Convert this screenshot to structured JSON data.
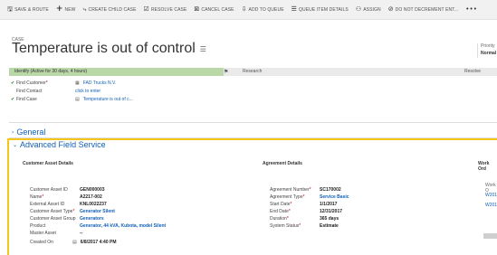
{
  "toolbar": {
    "items": [
      {
        "icon": "save-icon",
        "glyph": "🖫",
        "label": "SAVE & ROUTE"
      },
      {
        "icon": "add-icon",
        "glyph": "+",
        "label": "NEW"
      },
      {
        "icon": "create-child-icon",
        "glyph": "⤷",
        "label": "CREATE CHILD CASE"
      },
      {
        "icon": "resolve-icon",
        "glyph": "☑",
        "label": "RESOLVE CASE"
      },
      {
        "icon": "cancel-case-icon",
        "glyph": "⊠",
        "label": "CANCEL CASE"
      },
      {
        "icon": "queue-icon",
        "glyph": "⇩",
        "label": "ADD TO QUEUE"
      },
      {
        "icon": "queue-details-icon",
        "glyph": "☰",
        "label": "QUEUE ITEM DETAILS"
      },
      {
        "icon": "assign-icon",
        "glyph": "⚇",
        "label": "ASSIGN"
      },
      {
        "icon": "no-decrement-icon",
        "glyph": "⊘",
        "label": "DO NOT DECREMENT ENT..."
      },
      {
        "icon": "more-icon",
        "glyph": "•••",
        "label": ""
      }
    ]
  },
  "header": {
    "record_type": "CASE",
    "title": "Temperature is out of control",
    "menu_glyph": "☰",
    "priority_label": "Priority",
    "priority_value": "Normal"
  },
  "process": {
    "stage1": "Identify (Active for 30 days, 4 hours)",
    "flag_glyph": "⚑",
    "stage2": "Research",
    "stage3": "Resolve",
    "steps": [
      {
        "check": "✔",
        "label": "Find Customer",
        "required": "*",
        "icon": "▦",
        "value": "FAD Trucks N.V."
      },
      {
        "check": "",
        "label": "Find Contact",
        "required": "",
        "icon": "",
        "value": "click to enter"
      },
      {
        "check": "✔",
        "label": "Find Case",
        "required": "",
        "icon": "▤",
        "value": "Temperature is out of c..."
      }
    ]
  },
  "general": {
    "label": "General",
    "chevron": "›"
  },
  "afs": {
    "label": "Advanced Field Service",
    "chevron": "⌄",
    "customer_asset": {
      "heading": "Customer Asset Details",
      "fields": [
        {
          "label": "Customer Asset ID",
          "req": "",
          "value": "GEN000003",
          "link": false
        },
        {
          "label": "Name",
          "req": "*",
          "value": "A2217-002",
          "link": false
        },
        {
          "label": "External Asset ID",
          "req": "",
          "value": "KNL0022237",
          "link": false
        },
        {
          "label": "Customer Asset Type",
          "req": "*",
          "value": "Generator Silent",
          "link": true
        },
        {
          "label": "Customer Asset Group",
          "req": "",
          "value": "Generators",
          "link": true
        },
        {
          "label": "Product",
          "req": "",
          "value": "Generator, 44 kVA, Kubota, model Silent",
          "link": true
        },
        {
          "label": "Master Asset",
          "req": "",
          "value": "--",
          "link": false
        },
        {
          "label": "Created On",
          "req": "",
          "value": "6/8/2017   4:40 PM",
          "link": false
        }
      ]
    },
    "agreement": {
      "heading": "Agreement Details",
      "fields": [
        {
          "label": "Agreement Number",
          "req": "*",
          "value": "SC170002",
          "link": false
        },
        {
          "label": "Agreement Type",
          "req": "*",
          "value": "Service Basic",
          "link": true
        },
        {
          "label": "Start Date",
          "req": "*",
          "value": "1/1/2017",
          "link": false
        },
        {
          "label": "End Date",
          "req": "*",
          "value": "12/31/2017",
          "link": false
        },
        {
          "label": "Duration",
          "req": "*",
          "value": "365 days",
          "link": false
        },
        {
          "label": "System Status",
          "req": "*",
          "value": "Estimate",
          "link": false
        }
      ]
    },
    "work_orders": {
      "heading": "Work Ord",
      "items": [
        "Work O",
        "W2017",
        "W2017"
      ]
    }
  }
}
